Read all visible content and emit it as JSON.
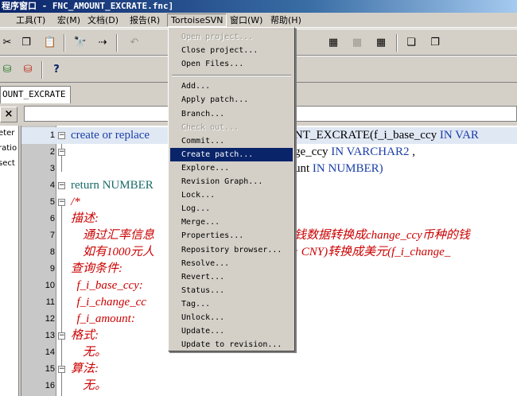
{
  "window": {
    "title": "程序窗口 - FNC_AMOUNT_EXCRATE.fnc]"
  },
  "menubar": [
    {
      "label": "工具(T)",
      "name": "menu-tools"
    },
    {
      "label": "宏(M)",
      "name": "menu-macro"
    },
    {
      "label": "文档(D)",
      "name": "menu-documents"
    },
    {
      "label": "报告(R)",
      "name": "menu-reports"
    },
    {
      "label": "TortoiseSVN",
      "name": "menu-tortoisesvn"
    },
    {
      "label": "窗口(W)",
      "name": "menu-window"
    },
    {
      "label": "帮助(H)",
      "name": "menu-help"
    }
  ],
  "tab": {
    "label": "OUNT_EXCRATE"
  },
  "close_label": "×",
  "left_panel": [
    "eter",
    "ratio",
    "sect"
  ],
  "editor": {
    "lines": [
      {
        "n": "1",
        "fold": "⊟"
      },
      {
        "n": "2",
        "fold": "⊟"
      },
      {
        "n": "3",
        "fold": ""
      },
      {
        "n": "4",
        "fold": "⊟"
      },
      {
        "n": "5",
        "fold": "⊟"
      },
      {
        "n": "6",
        "fold": ""
      },
      {
        "n": "7",
        "fold": ""
      },
      {
        "n": "8",
        "fold": ""
      },
      {
        "n": "9",
        "fold": ""
      },
      {
        "n": "10",
        "fold": ""
      },
      {
        "n": "11",
        "fold": ""
      },
      {
        "n": "12",
        "fold": ""
      },
      {
        "n": "13",
        "fold": "⊟"
      },
      {
        "n": "14",
        "fold": ""
      },
      {
        "n": "15",
        "fold": "⊟"
      },
      {
        "n": "16",
        "fold": ""
      }
    ],
    "code": {
      "l1a": "create or replace",
      "l1b": "NT_EXCRATE(f_i_base_ccy ",
      "l1c": "IN VAR",
      "l2a": "ge_ccy ",
      "l2b": "IN VARCHAR2",
      "l2c": " ,",
      "l3a": "unt ",
      "l3b": "IN NUMBER)",
      "l4": "return NUMBER",
      "l5": "/*",
      "l6": "描述:",
      "l7a": "    通过汇率信息",
      "l7b": "钱数据转换成change_ccy币种的钱",
      "l8a": "    如有1000元人",
      "l8b": ": CNY)转换成美元(f_i_change_",
      "l9": "查询条件:",
      "l10": "  f_i_base_ccy:",
      "l11": "  f_i_change_cc",
      "l12": "  f_i_amount:",
      "l13": "格式:",
      "l14": "    无。",
      "l15": "算法:",
      "l16": "    无。"
    }
  },
  "svn_menu": [
    {
      "label": "Open project...",
      "state": "disabled",
      "name": "svn-open-project"
    },
    {
      "label": "Close project...",
      "state": "normal",
      "name": "svn-close-project"
    },
    {
      "label": "Open Files...",
      "state": "normal",
      "name": "svn-open-files"
    },
    {
      "sep": true
    },
    {
      "label": "Add...",
      "state": "normal",
      "name": "svn-add"
    },
    {
      "label": "Apply patch...",
      "state": "normal",
      "name": "svn-apply-patch"
    },
    {
      "label": "Branch...",
      "state": "normal",
      "name": "svn-branch"
    },
    {
      "label": "Check out...",
      "state": "disabled",
      "name": "svn-check-out"
    },
    {
      "label": "Commit...",
      "state": "normal",
      "name": "svn-commit"
    },
    {
      "label": "Create patch...",
      "state": "selected",
      "name": "svn-create-patch"
    },
    {
      "label": "Explore...",
      "state": "normal",
      "name": "svn-explore"
    },
    {
      "label": "Revision Graph...",
      "state": "normal",
      "name": "svn-revision-graph"
    },
    {
      "label": "Lock...",
      "state": "normal",
      "name": "svn-lock"
    },
    {
      "label": "Log...",
      "state": "normal",
      "name": "svn-log"
    },
    {
      "label": "Merge...",
      "state": "normal",
      "name": "svn-merge"
    },
    {
      "label": "Properties...",
      "state": "normal",
      "name": "svn-properties"
    },
    {
      "label": "Repository browser...",
      "state": "normal",
      "name": "svn-repo-browser"
    },
    {
      "label": "Resolve...",
      "state": "normal",
      "name": "svn-resolve"
    },
    {
      "label": "Revert...",
      "state": "normal",
      "name": "svn-revert"
    },
    {
      "label": "Status...",
      "state": "normal",
      "name": "svn-status"
    },
    {
      "label": "Tag...",
      "state": "normal",
      "name": "svn-tag"
    },
    {
      "label": "Unlock...",
      "state": "normal",
      "name": "svn-unlock"
    },
    {
      "label": "Update...",
      "state": "normal",
      "name": "svn-update"
    },
    {
      "label": "Update to revision...",
      "state": "normal",
      "name": "svn-update-to-revision"
    }
  ],
  "toolbar_icons": {
    "row1": [
      "scissors-icon",
      "copy-icon",
      "paste-icon",
      "binoculars-icon",
      "find-next-icon"
    ],
    "row2": [
      "db-icon",
      "db-red-icon",
      "help-icon"
    ],
    "help_label": "?"
  }
}
